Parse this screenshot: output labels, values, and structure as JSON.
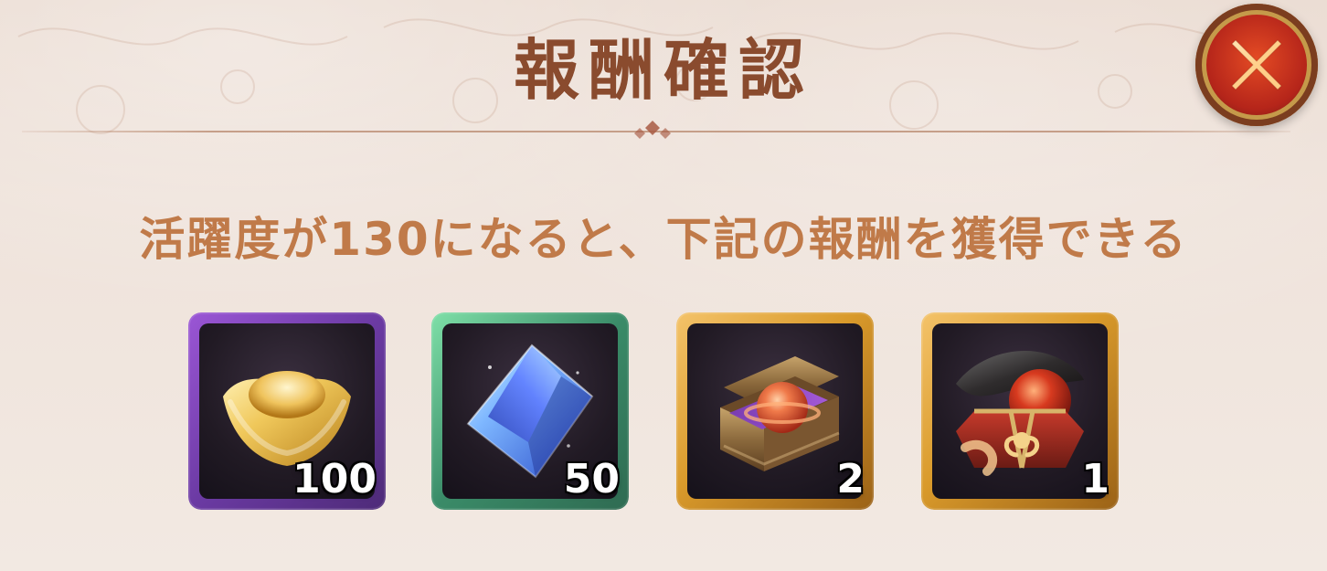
{
  "dialog": {
    "title": "報酬確認",
    "subtitle": "活躍度が130になると、下記の報酬を獲得できる"
  },
  "close_button": {
    "icon": "close-icon"
  },
  "rewards": [
    {
      "icon": "gold-ingot-icon",
      "quantity": "100",
      "frame_color": "#8b4dc6"
    },
    {
      "icon": "blue-gem-icon",
      "quantity": "50",
      "frame_color": "#4aa07a"
    },
    {
      "icon": "orb-chest-icon",
      "quantity": "2",
      "frame_color": "#d6a24a"
    },
    {
      "icon": "gift-box-orb-icon",
      "quantity": "1",
      "frame_color": "#d6a24a"
    }
  ],
  "colors": {
    "title": "#8a4b2e",
    "subtitle": "#c07a49",
    "close_red": "#d43a1f"
  }
}
